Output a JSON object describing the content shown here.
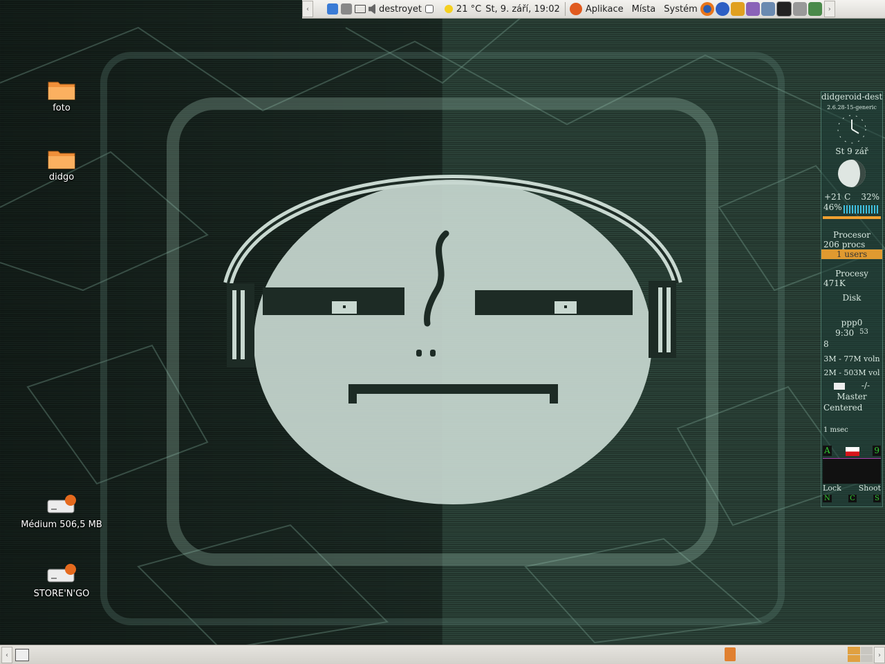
{
  "top_panel": {
    "user": "destroyet",
    "weather": "21 °C",
    "datetime": "St,  9. září, 19:02",
    "menu": {
      "applications": "Aplikace",
      "places": "Místa",
      "system": "Systém"
    },
    "tray_icons": [
      "bluetooth-icon",
      "network-icon",
      "mail-icon",
      "volume-icon"
    ],
    "launchers": [
      "firefox-icon",
      "help-icon",
      "music-icon",
      "game-icon",
      "app-icon",
      "terminal-icon",
      "screenshot-icon",
      "editor-icon"
    ]
  },
  "desktop": {
    "icons": [
      {
        "label": "foto",
        "type": "folder"
      },
      {
        "label": "didgo",
        "type": "folder"
      },
      {
        "label": "Médium 506,5 MB",
        "type": "drive"
      },
      {
        "label": "STORE'N'GO",
        "type": "drive"
      }
    ]
  },
  "widgets": {
    "hostname": "didgeroid-destr",
    "kernel": "2.6.28-15-generic",
    "date": "St 9 zář",
    "temp": "+21 C",
    "humidity": "32%",
    "cpu_percent": "46%",
    "cpu_title": "Procesor",
    "procs": "206 procs",
    "users": "1 users",
    "processes_title": "Procesy",
    "mem": "471K",
    "disk_title": "Disk",
    "net_iface": "ppp0",
    "net_time": "9:30",
    "net_value": "53",
    "net_count": "8",
    "fs1": "3M - 77M voln",
    "fs2": "2M - 503M vol",
    "mail": "-/-",
    "mixer": "Master",
    "mode": "Centered",
    "ping": "1 msec",
    "kb_letter": "A",
    "kb_num": "9",
    "lock": "Lock",
    "shoot": "Shoot",
    "leds": [
      "N",
      "C",
      "S"
    ]
  },
  "colors": {
    "panel": "#dcdad5",
    "folder": "#f0903a",
    "face": "#c8d8d0",
    "dark": "#1d2b25"
  }
}
